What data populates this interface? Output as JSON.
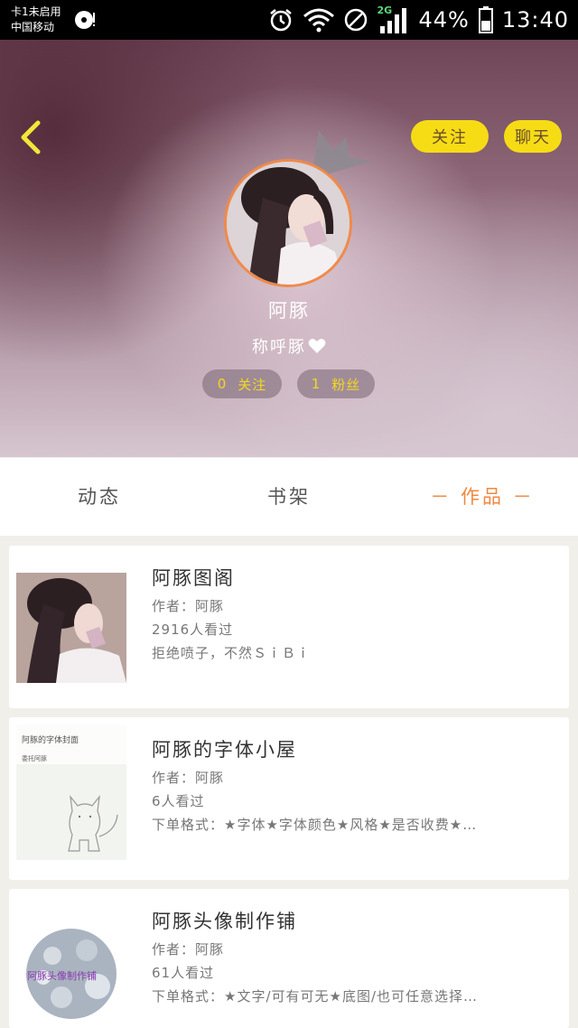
{
  "status_bar": {
    "carrier_line1": "卡1未启用",
    "carrier_line2": "中国移动",
    "network": "2G",
    "battery": "44%",
    "time": "13:40"
  },
  "header": {
    "follow_button": "关注",
    "chat_button": "聊天",
    "username": "阿豚",
    "nickname": "称呼豚",
    "following_count": "0",
    "following_label": "关注",
    "fans_count": "1",
    "fans_label": "粉丝"
  },
  "tabs": [
    {
      "label": "动态"
    },
    {
      "label": "书架"
    },
    {
      "label": "－ 作品 －"
    }
  ],
  "works": [
    {
      "title": "阿豚图阁",
      "author": "作者：阿豚",
      "views": "2916人看过",
      "description": "拒绝喷子，不然ＳｉＢｉ"
    },
    {
      "title": "阿豚的字体小屋",
      "author": "作者：阿豚",
      "views": "6人看过",
      "description": "下单格式：★字体★字体颜色★风格★是否收费★…",
      "thumb_text_1": "阿豚的字体封面",
      "thumb_text_2": "委托阿豚"
    },
    {
      "title": "阿豚头像制作铺",
      "author": "作者：阿豚",
      "views": "61人看过",
      "description": "下单格式：★文字/可有可无★底图/也可任意选择…",
      "thumb_text": "阿豚头像制作铺"
    }
  ],
  "colors": {
    "accent_yellow": "#f6dc15",
    "accent_orange": "#f08840"
  }
}
